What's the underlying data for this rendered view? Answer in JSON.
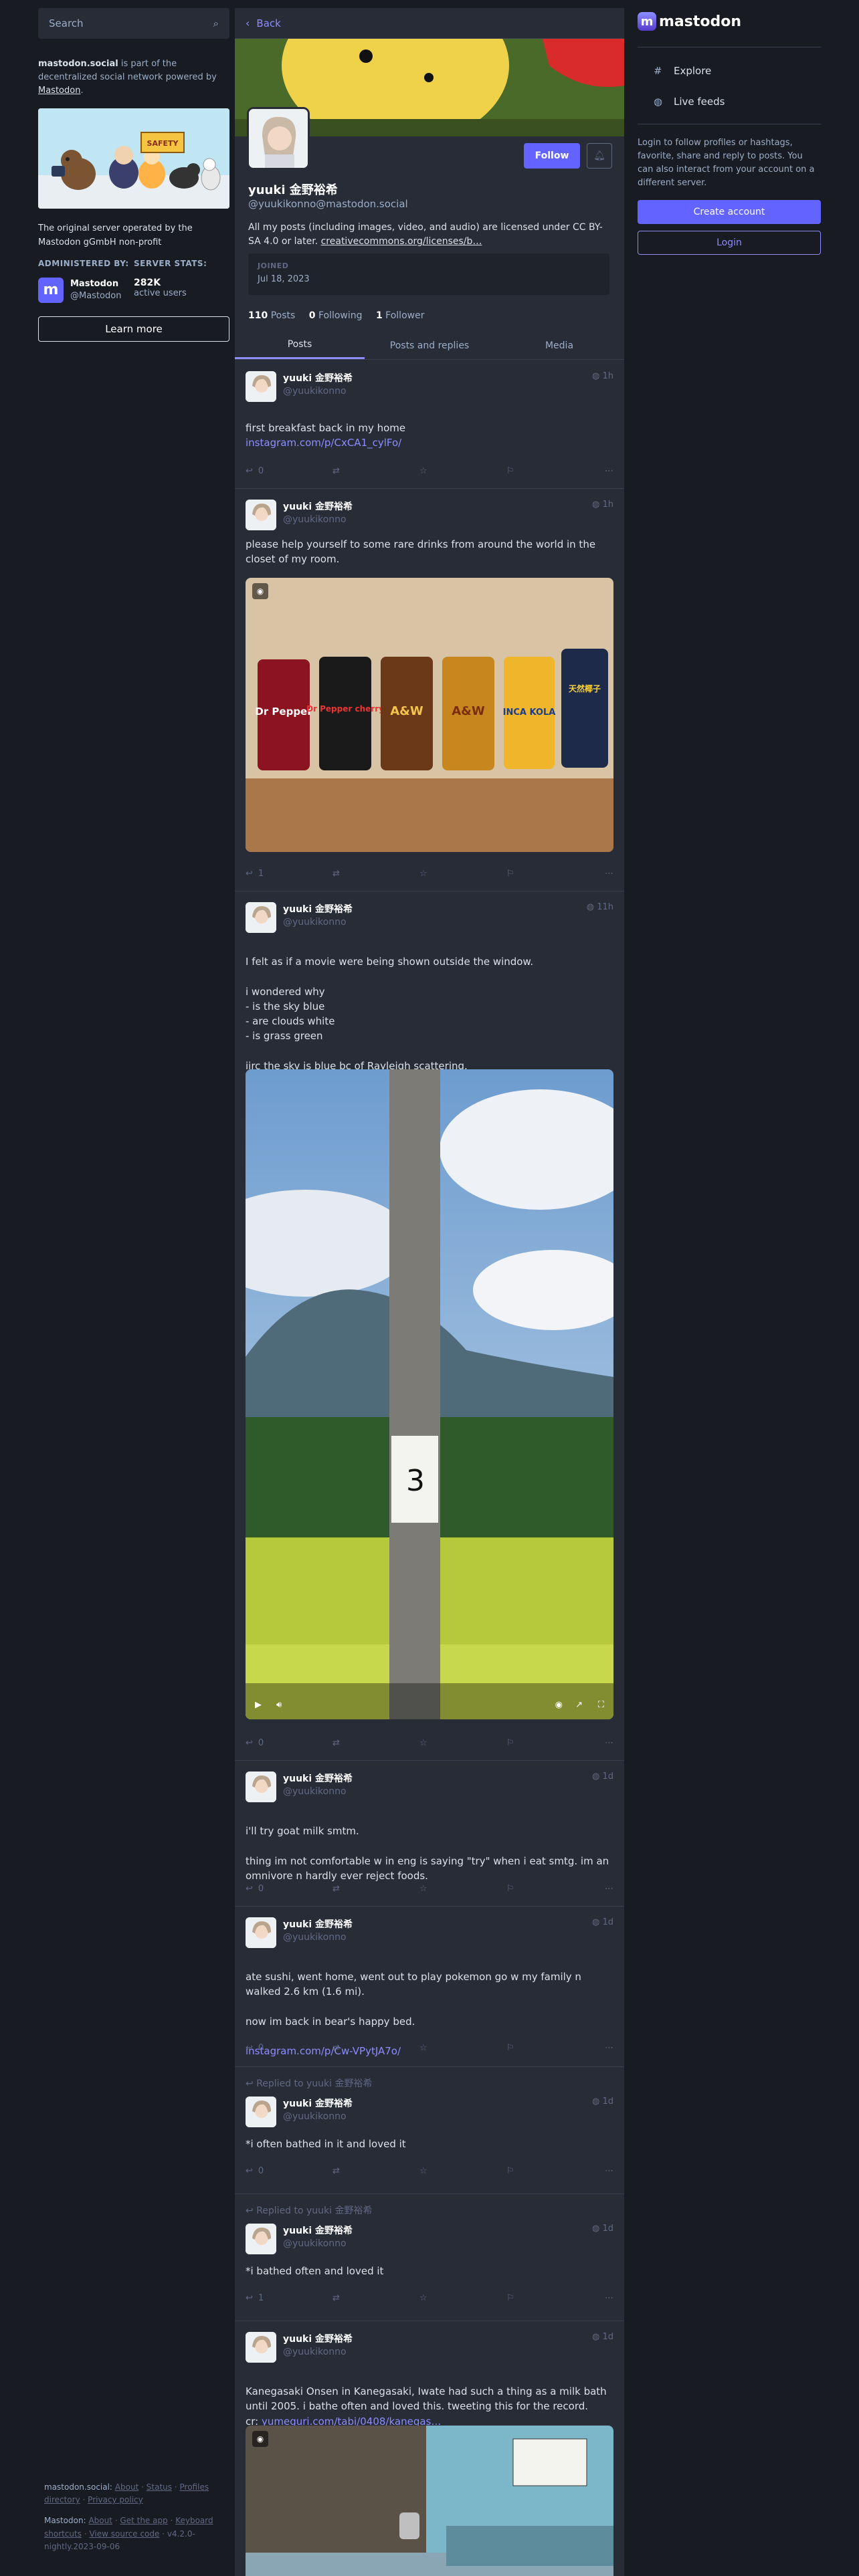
{
  "left": {
    "search_placeholder": "Search",
    "server_name": "mastodon.social",
    "server_desc": " is part of the decentralized social network powered by ",
    "mastodon_link": "Mastodon",
    "period": ".",
    "tagline": "The original server operated by the Mastodon gGmbH non-profit",
    "administered_by_label": "ADMINISTERED BY:",
    "server_stats_label": "SERVER STATS:",
    "admin_name": "Mastodon",
    "admin_handle": "@Mastodon",
    "active_users": "282K",
    "active_users_label": "active users",
    "learn_more": "Learn more",
    "hero_sign": "SAFETY"
  },
  "footer": {
    "server_label": "mastodon.social:",
    "about": "About",
    "status": "Status",
    "profiles_directory": "Profiles directory",
    "privacy_policy": "Privacy policy",
    "mastodon_label": "Mastodon:",
    "about2": "About",
    "get_app": "Get the app",
    "keyboard_shortcuts": "Keyboard shortcuts",
    "view_source": "View source code",
    "version": "v4.2.0-nightly.2023-09-06",
    "dot": "·"
  },
  "profile": {
    "back": "Back",
    "follow": "Follow",
    "name": "yuuki 金野裕希",
    "handle": "@yuukikonno@mastodon.social",
    "bio": "All my posts (including images, video, and audio) are licensed under CC BY-SA 4.0 or later. ",
    "bio_link": "creativecommons.org/licenses/b…",
    "joined_label": "JOINED",
    "joined_date": "Jul 18, 2023",
    "posts_count": "110",
    "posts_label": "Posts",
    "following_count": "0",
    "following_label": "Following",
    "followers_count": "1",
    "followers_label": "Follower"
  },
  "tabs": [
    "Posts",
    "Posts and replies",
    "Media"
  ],
  "posts": [
    {
      "name": "yuuki 金野裕希",
      "handle": "@yuukikonno",
      "time": "1h",
      "text": "first breakfast back in my home",
      "link": "instagram.com/p/CxCA1_cylFo/",
      "replies": "0"
    },
    {
      "name": "yuuki 金野裕希",
      "handle": "@yuukikonno",
      "time": "1h",
      "text": "please help yourself to some rare drinks from around the world in the closet of my room.",
      "replies": "1"
    },
    {
      "name": "yuuki 金野裕希",
      "handle": "@yuukikonno",
      "time": "11h",
      "text": "I felt as if a movie were being shown outside the window.\n\ni wondered why\n- is the sky blue\n- are clouds white\n- is grass green\n\niirc the sky is blue bc of Rayleigh scattering.",
      "replies": "0"
    },
    {
      "name": "yuuki 金野裕希",
      "handle": "@yuukikonno",
      "time": "1d",
      "text": "i'll try goat milk smtm.\n\nthing im not comfortable w in eng is saying \"try\" when i eat smtg. im an omnivore n hardly ever reject foods.",
      "replies": "0"
    },
    {
      "name": "yuuki 金野裕希",
      "handle": "@yuukikonno",
      "time": "1d",
      "text": "ate sushi, went home, went out to play pokemon go w my family n walked 2.6 km (1.6 mi).\n\nnow im back in bear's happy bed.",
      "link": "instagram.com/p/Cw-VPytJA7o/",
      "replies": "0"
    },
    {
      "reply_to": "Replied to yuuki 金野裕希",
      "name": "yuuki 金野裕希",
      "handle": "@yuukikonno",
      "time": "1d",
      "text": "*i often bathed in it and loved it",
      "replies": "0"
    },
    {
      "reply_to": "Replied to yuuki 金野裕希",
      "name": "yuuki 金野裕希",
      "handle": "@yuukikonno",
      "time": "1d",
      "text": "*i bathed often and loved it",
      "replies": "1"
    },
    {
      "name": "yuuki 金野裕希",
      "handle": "@yuukikonno",
      "time": "1d",
      "text": "Kanegasaki Onsen in Kanegasaki, Iwate had such a thing as a milk bath until 2005. i bathe often and loved this. tweeting this for the record.\ncr: ",
      "link": "yumeguri.com/tabi/0408/kanegas…"
    }
  ],
  "drinks": {
    "can1": "Dr Pepper",
    "can2": "Dr Pepper cherry",
    "can3": "A&W",
    "can4": "A&W",
    "can5": "INCA KOLA",
    "can6": "天然椰子"
  },
  "pole_number": "3",
  "onsen_sign": "",
  "right": {
    "logo": "mastodon",
    "explore": "Explore",
    "live_feeds": "Live feeds",
    "login_text": "Login to follow profiles or hashtags, favorite, share and reply to posts. You can also interact from your account on a different server.",
    "create_account": "Create account",
    "login": "Login"
  }
}
